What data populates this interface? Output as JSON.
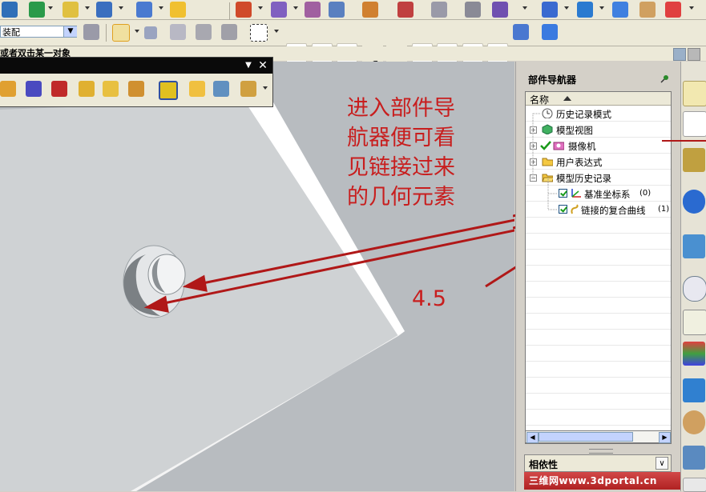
{
  "toolbar": {
    "filter_value": "装配",
    "status_text": "或者双击某一对象"
  },
  "annotation": {
    "lines": [
      "进入部件导",
      "航器便可看",
      "见链接过来",
      "的几何元素"
    ],
    "number": "4.5"
  },
  "navigator": {
    "title": "部件导航器",
    "column_header": "名称",
    "nodes": [
      {
        "label": "历史记录模式",
        "icon": "clock-icon",
        "expander": "none",
        "checked": false
      },
      {
        "label": "模型视图",
        "icon": "model-view-icon",
        "expander": "+",
        "checked": false
      },
      {
        "label": "摄像机",
        "icon": "camera-icon",
        "expander": "+",
        "checked": true
      },
      {
        "label": "用户表达式",
        "icon": "folder-icon",
        "expander": "+",
        "checked": false
      },
      {
        "label": "模型历史记录",
        "icon": "folder-icon",
        "expander": "-",
        "checked": false
      },
      {
        "label": "基准坐标系",
        "count": "(0)",
        "icon": "datum-csys-icon",
        "checked": true
      },
      {
        "label": "链接的复合曲线",
        "count": "(1)",
        "icon": "linked-curve-icon",
        "checked": true
      }
    ],
    "dependency_label": "相依性",
    "watermark": "三维网www.3dportal.cn"
  },
  "colors": {
    "annotation": "#c81e1e",
    "part_face": "#cfd2d4",
    "viewport_bg": "#b8bcc0"
  }
}
